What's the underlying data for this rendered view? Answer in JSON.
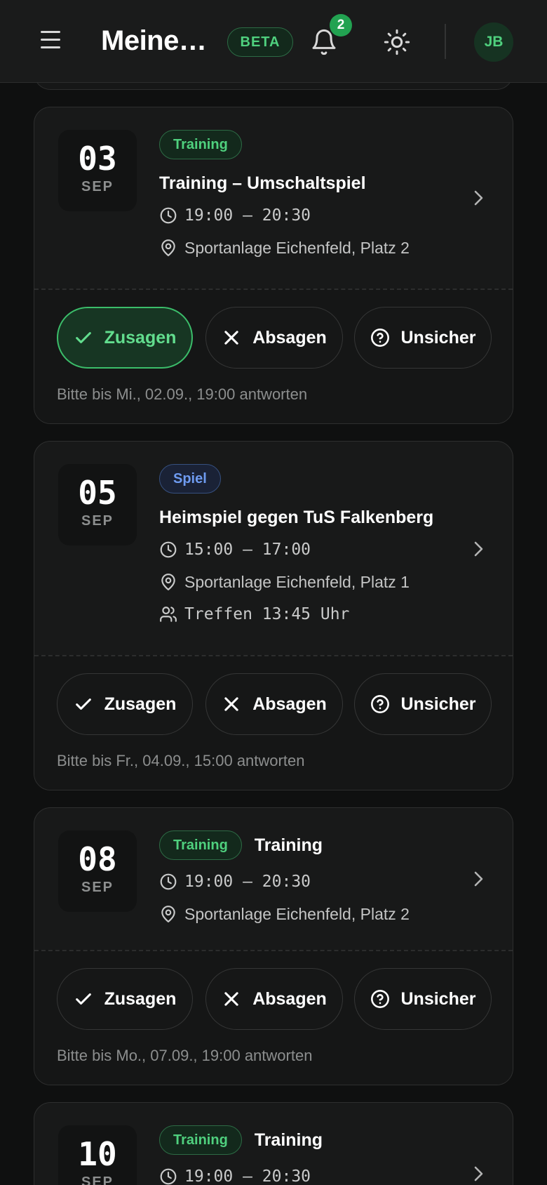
{
  "header": {
    "title": "Meine…",
    "beta_label": "BETA",
    "notification_count": "2",
    "avatar_initials": "JB"
  },
  "rsvp_labels": {
    "accept": "Zusagen",
    "decline": "Absagen",
    "unsure": "Unsicher"
  },
  "events": [
    {
      "day": "03",
      "month": "SEP",
      "tag": "Training",
      "title": "Training – Umschaltspiel",
      "time": "19:00 – 20:30",
      "location": "Sportanlage Eichenfeld, Platz 2",
      "deadline": "Bitte bis Mi., 02.09., 19:00 antworten",
      "selected": "accept"
    },
    {
      "day": "05",
      "month": "SEP",
      "tag": "Spiel",
      "title": "Heimspiel gegen TuS Falkenberg",
      "time": "15:00 – 17:00",
      "location": "Sportanlage Eichenfeld, Platz 1",
      "meeting": "Treffen 13:45 Uhr",
      "deadline": "Bitte bis Fr., 04.09., 15:00 antworten",
      "selected": ""
    },
    {
      "day": "08",
      "month": "SEP",
      "tag": "Training",
      "title": "Training",
      "time": "19:00 – 20:30",
      "location": "Sportanlage Eichenfeld, Platz 2",
      "deadline": "Bitte bis Mo., 07.09., 19:00 antworten",
      "selected": ""
    },
    {
      "day": "10",
      "month": "SEP",
      "tag": "Training",
      "title": "Training",
      "time": "19:00 – 20:30"
    }
  ],
  "colors": {
    "accent_green": "#4fd07e",
    "spiel_blue": "#6e9bf0",
    "background": "#0f1010"
  }
}
